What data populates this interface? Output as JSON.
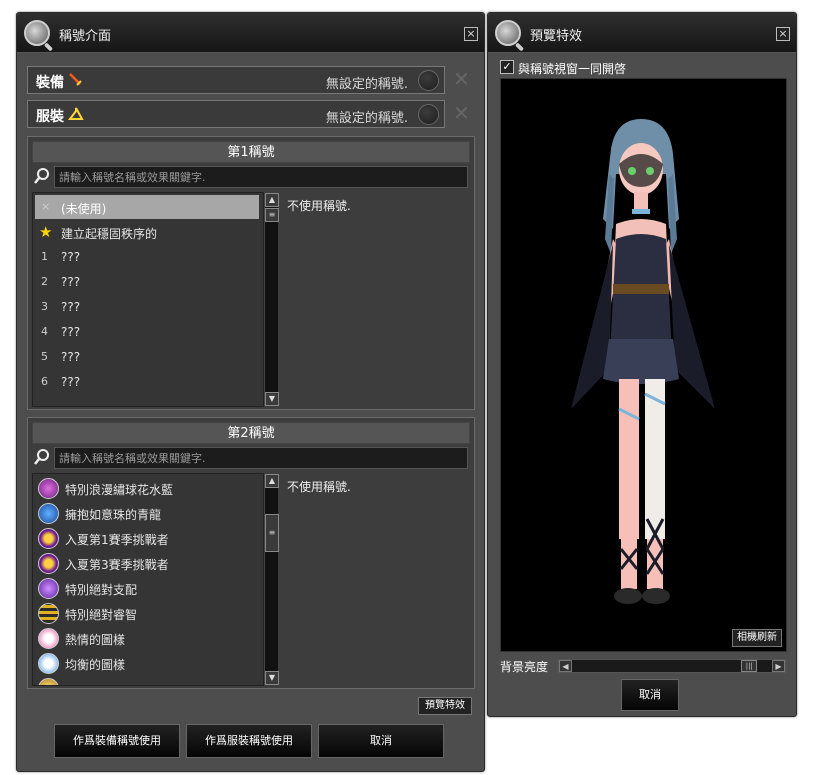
{
  "title_window": {
    "title": "稱號介面",
    "close": "×",
    "slots": [
      {
        "label": "裝備",
        "icon": "sword-icon",
        "value": "無設定的稱號."
      },
      {
        "label": "服裝",
        "icon": "hanger-icon",
        "value": "無設定的稱號."
      }
    ],
    "slot_clear": "✕",
    "section1": {
      "heading": "第1稱號",
      "search_placeholder": "請輸入稱號名稱或效果關鍵字.",
      "items": [
        {
          "idx": "×",
          "text": "(未使用)",
          "selected": true
        },
        {
          "idx": "★",
          "text": "建立起穩固秩序的"
        },
        {
          "idx": "1",
          "text": "???"
        },
        {
          "idx": "2",
          "text": "???"
        },
        {
          "idx": "3",
          "text": "???"
        },
        {
          "idx": "4",
          "text": "???"
        },
        {
          "idx": "5",
          "text": "???"
        },
        {
          "idx": "6",
          "text": "???"
        }
      ],
      "description": "不使用稱號."
    },
    "section2": {
      "heading": "第2稱號",
      "search_placeholder": "請輸入稱號名稱或效果關鍵字.",
      "items": [
        {
          "text": "特別浪漫繡球花水藍",
          "icon_color": "#b040c0"
        },
        {
          "text": "擁抱如意珠的青龍",
          "icon_color": "#2a6fd0"
        },
        {
          "text": "入夏第1賽季挑戰者",
          "icon_color": "#7a2aa0"
        },
        {
          "text": "入夏第3賽季挑戰者",
          "icon_color": "#7a2aa0"
        },
        {
          "text": "特別絕對支配",
          "icon_color": "#8a30d8"
        },
        {
          "text": "特別絕對睿智",
          "icon_color": "#c8a020"
        },
        {
          "text": "熱情的圖樣",
          "icon_color": "#f0a0c0"
        },
        {
          "text": "均衡的圖樣",
          "icon_color": "#a0c8f0"
        }
      ],
      "description": "不使用稱號."
    },
    "preview_effect_button": "預覽特效",
    "buttons": {
      "equip": "作爲裝備稱號使用",
      "costume": "作爲服裝稱號使用",
      "cancel": "取消"
    }
  },
  "preview_window": {
    "title": "預覽特效",
    "close": "×",
    "open_together_label": "與稱號視窗一同開啓",
    "open_together_checked": true,
    "camera_reset": "相機刷新",
    "brightness_label": "背景亮度",
    "brightness_level": 0.92,
    "cancel": "取消"
  }
}
